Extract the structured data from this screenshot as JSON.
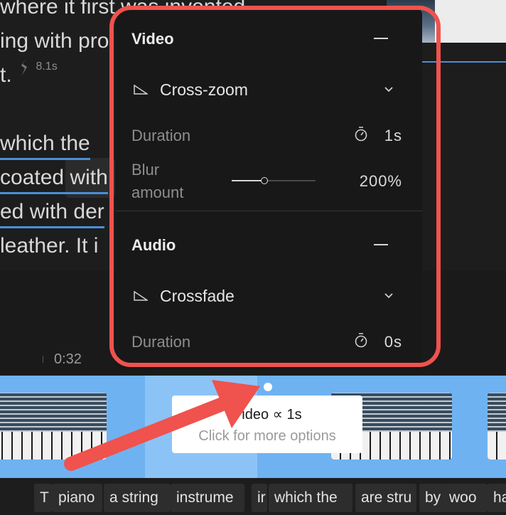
{
  "transcript": {
    "lines": [
      "where it first was invented",
      "ing with pro",
      "t.",
      " which the",
      "coated with",
      "ed with der",
      "leather. It i"
    ],
    "pause_duration": "8.1s"
  },
  "timeline": {
    "time_label": "0:32"
  },
  "tooltip": {
    "title": "Video ∝ 1s",
    "subtitle": "Click for more options"
  },
  "words": [
    "T",
    "piano",
    "a string",
    "instrume",
    "ir",
    "which the",
    "are stru",
    "by",
    "woo",
    "ha"
  ],
  "panel": {
    "video": {
      "title": "Video",
      "effect": "Cross-zoom",
      "duration_label": "Duration",
      "duration_value": "1s",
      "blur_label_1": "Blur",
      "blur_label_2": "amount",
      "blur_value": "200%",
      "blur_level_fraction": 0.39
    },
    "audio": {
      "title": "Audio",
      "effect": "Crossfade",
      "duration_label": "Duration",
      "duration_value": "0s"
    }
  },
  "colors": {
    "accent_red": "#f0524d",
    "timeline_blue": "#6fb2f2",
    "underline_blue": "#4b8fd9"
  }
}
